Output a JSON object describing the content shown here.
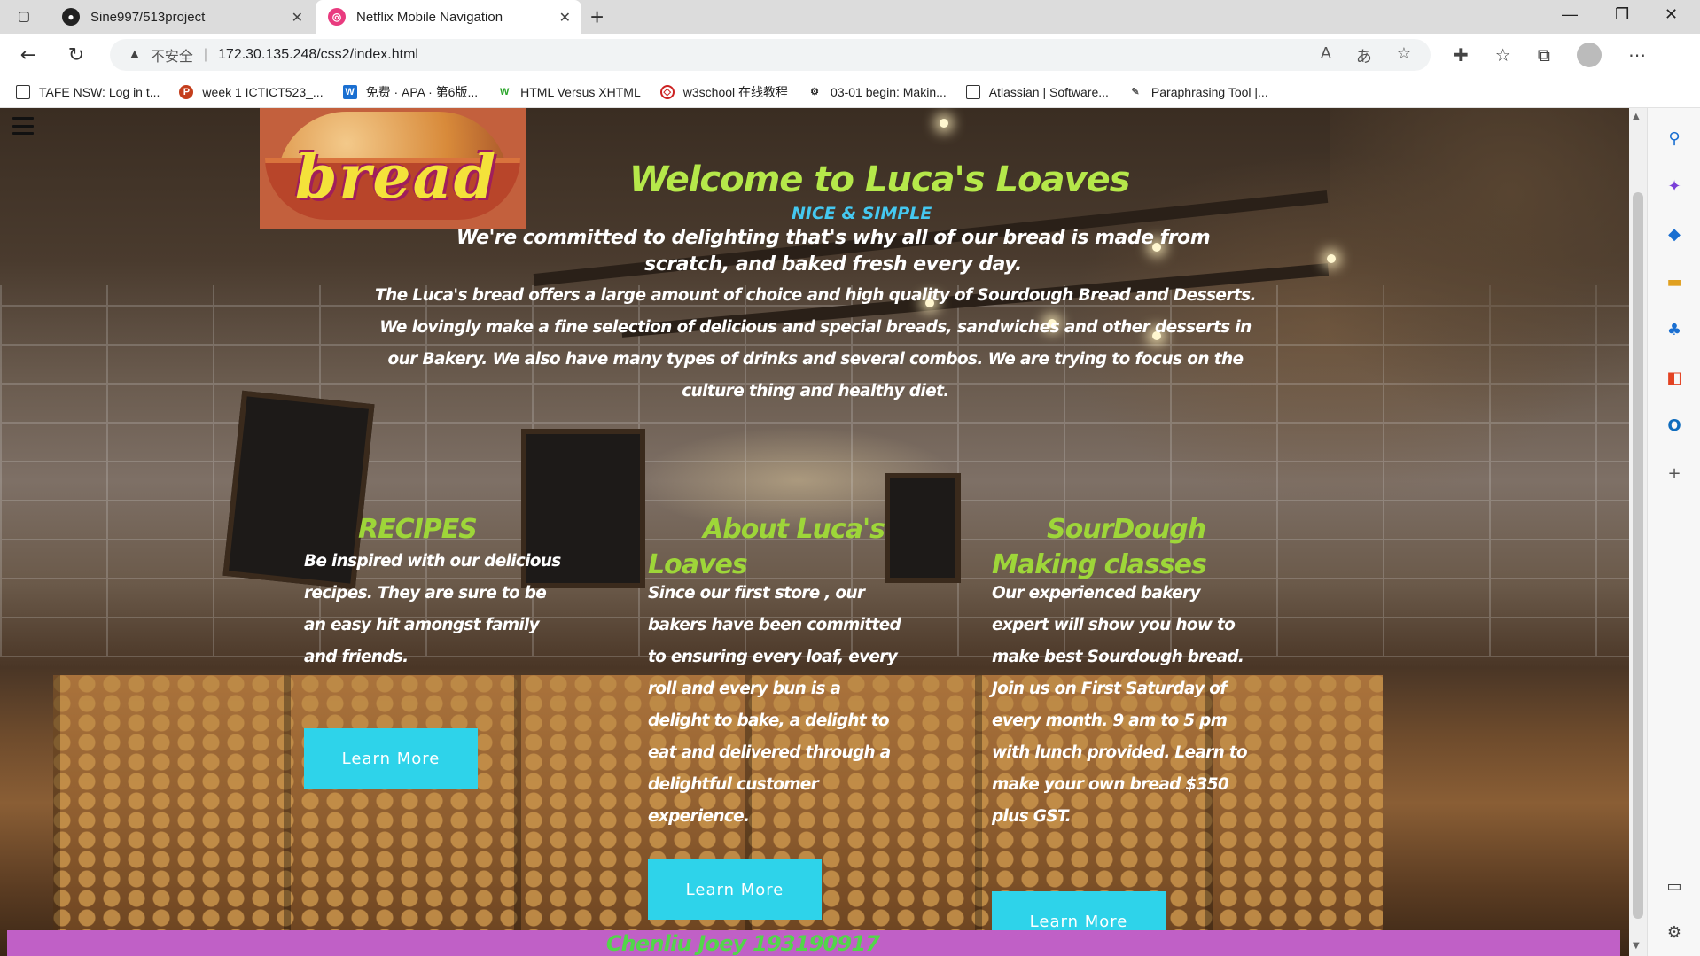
{
  "browser": {
    "tabs": [
      {
        "title": "Sine997/513project",
        "icon": "github-icon"
      },
      {
        "title": "Netflix Mobile Navigation",
        "icon": "site-icon"
      }
    ],
    "address": {
      "security_label": "不安全",
      "url": "172.30.135.248/css2/index.html"
    },
    "bookmarks": [
      {
        "label": "TAFE NSW: Log in t...",
        "icon": "page-icon"
      },
      {
        "label": "week 1 ICTICT523_...",
        "icon": "powerpoint-icon"
      },
      {
        "label": "免费 · APA · 第6版...",
        "icon": "w-icon"
      },
      {
        "label": "HTML Versus XHTML",
        "icon": "w3-icon"
      },
      {
        "label": "w3school 在线教程",
        "icon": "w3school-icon"
      },
      {
        "label": "03-01 begin: Makin...",
        "icon": "gear-icon"
      },
      {
        "label": "Atlassian | Software...",
        "icon": "page-icon"
      },
      {
        "label": "Paraphrasing Tool |...",
        "icon": "feather-icon"
      }
    ]
  },
  "site": {
    "logo_text": "bread",
    "title": "Welcome to Luca's Loaves",
    "subtitle": "NICE & SIMPLE",
    "lead": "We're committed to delighting that's why all of our bread is made from scratch, and baked fresh every day.",
    "intro": "The Luca's bread offers a large amount of choice and high quality of Sourdough Bread and Desserts. We lovingly make a fine selection of delicious and special breads, sandwiches and other desserts in our Bakery. We also have many types of drinks and several combos. We are trying to focus on the culture thing and healthy diet.",
    "columns": [
      {
        "heading": "RECIPES",
        "text": "Be inspired with our delicious recipes. They are sure to be an easy hit amongst family and friends.",
        "button": "Learn More"
      },
      {
        "heading": "About Luca's Loaves",
        "text": "Since our first store , our bakers have been committed to ensuring every loaf, every roll and every bun is a delight to bake, a delight to eat and delivered through a delightful customer experience.",
        "button": "Learn More"
      },
      {
        "heading": "SourDough Making classes",
        "text": "Our experienced bakery expert will show you how to make best Sourdough bread. Join us on First Saturday of every month. 9 am to 5 pm with lunch provided. Learn to make your own bread $350 plus GST.",
        "button": "Learn More"
      }
    ],
    "footer": "Chenliu Joey 193190917"
  },
  "colors": {
    "title": "#b5e84a",
    "subtitle": "#45c8f0",
    "heading": "#9ed639",
    "button": "#2ed3ea",
    "footer_bg": "#c060c6",
    "footer_text": "#52d64a"
  }
}
